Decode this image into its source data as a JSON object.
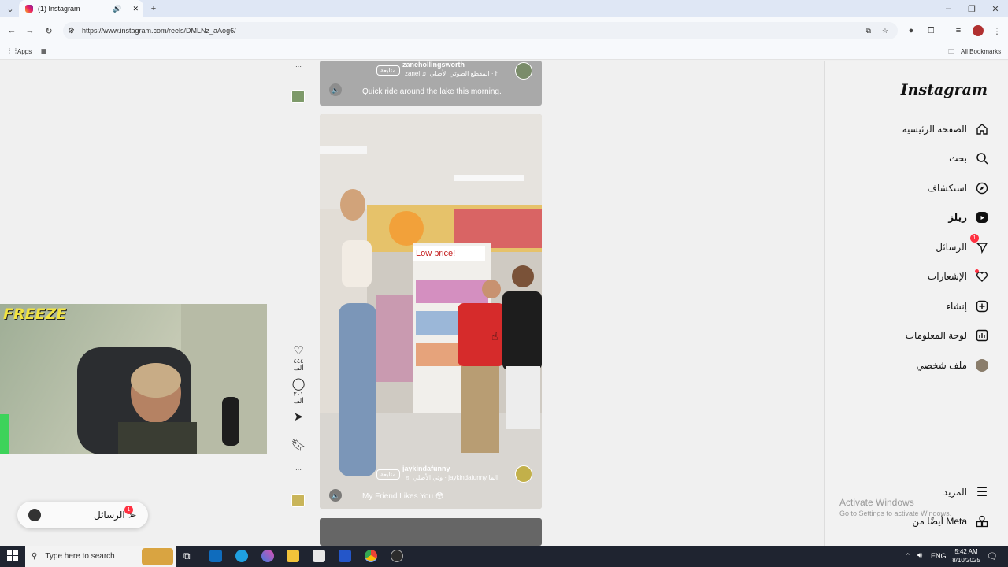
{
  "browser": {
    "tab_title": "(1) Instagram",
    "url": "https://www.instagram.com/reels/DMLNz_aAog6/",
    "bookmarks_apps": "Apps",
    "all_bookmarks": "All Bookmarks"
  },
  "nav": {
    "logo": "Instagram",
    "items": [
      {
        "label": "الصفحة الرئيسية",
        "icon": "home-icon"
      },
      {
        "label": "بحث",
        "icon": "search-icon"
      },
      {
        "label": "استكشاف",
        "icon": "compass-icon"
      },
      {
        "label": "ريلز",
        "icon": "reels-icon"
      },
      {
        "label": "الرسائل",
        "icon": "send-icon"
      },
      {
        "label": "الإشعارات",
        "icon": "heart-icon"
      },
      {
        "label": "إنشاء",
        "icon": "plus-icon"
      },
      {
        "label": "لوحة المعلومات",
        "icon": "dashboard-icon"
      },
      {
        "label": "ملف شخصي",
        "icon": "avatar-icon"
      }
    ],
    "messages_badge": "1",
    "more": "المزيد",
    "also_from_meta": "أيضًا من Meta"
  },
  "reel1": {
    "username": "zanehollingsworth",
    "follow": "متابعة",
    "audio": "zanel ♬ المقطع الصوتي الأصلي · h",
    "caption": "Quick ride around the lake this morning."
  },
  "reel2": {
    "username": "jaykindafunny",
    "follow": "متابعة",
    "audio": "♬ وتي الأصلي · jaykindafunny الما",
    "caption": "My Friend Likes You 😳",
    "store_sign": "Low price!"
  },
  "actions": {
    "likes": "٤٤٤ ألف",
    "comments": "٢٠١ ألف",
    "more": "···"
  },
  "overlay": {
    "cam_text": "FREEZE",
    "messages_label": "الرسائل",
    "messages_badge": "1"
  },
  "watermark": {
    "title": "Activate Windows",
    "subtitle": "Go to Settings to activate Windows."
  },
  "taskbar": {
    "search_placeholder": "Type here to search",
    "lang": "ENG",
    "time": "5:42 AM",
    "date": "8/10/2025"
  }
}
